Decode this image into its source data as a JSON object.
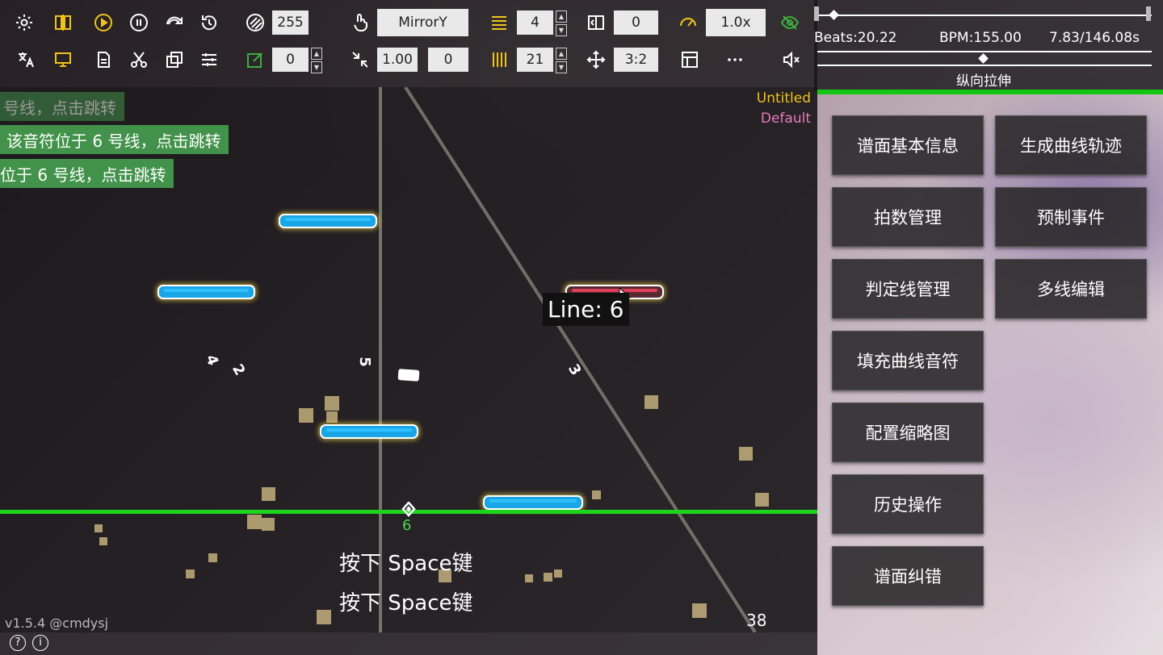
{
  "toolbar": {
    "row1": {
      "speed_value": "255",
      "mirror_label": "MirrorY",
      "line_count": "4",
      "offset_value": "0",
      "play_speed": "1.0x"
    },
    "row2": {
      "edit_value": "0",
      "scale_value": "1.00",
      "scale_offset": "0",
      "subdivision": "21",
      "aspect_ratio": "3:2"
    }
  },
  "timeline": {
    "beats": "Beats:20.22",
    "bpm": "BPM:155.00",
    "time": "7.83/146.08s",
    "stretch_label": "纵向拉伸"
  },
  "chart_header": {
    "title": "Untitled",
    "subtitle": "Default"
  },
  "jump_hints": [
    "号线，点击跳转",
    "该音符位于 6 号线，点击跳转",
    "位于 6 号线，点击跳转"
  ],
  "tooltip": "Line:  6",
  "line_numbers": [
    "4",
    "2",
    "5",
    "3"
  ],
  "judge_line_number": "6",
  "space_hints": [
    "按下 Space键",
    "按下 Space键"
  ],
  "combo": "38",
  "version": "v1.5.4 @cmdysj",
  "right_panel": {
    "buttons": [
      "谱面基本信息",
      "生成曲线轨迹",
      "拍数管理",
      "预制事件",
      "判定线管理",
      "多线编辑",
      "填充曲线音符",
      "配置缩略图",
      "历史操作",
      "谱面纠错"
    ]
  },
  "colors": {
    "accent": "#f0c419",
    "judge_line": "#13c613",
    "note_blue": "#2ec1ff",
    "title_color": "#f0c419",
    "subtitle_color": "#e77bbf"
  },
  "icons": {
    "settings": "gear-icon",
    "play": "play-icon",
    "pause": "pause-icon",
    "redo": "redo-icon",
    "replay": "replay-icon"
  }
}
